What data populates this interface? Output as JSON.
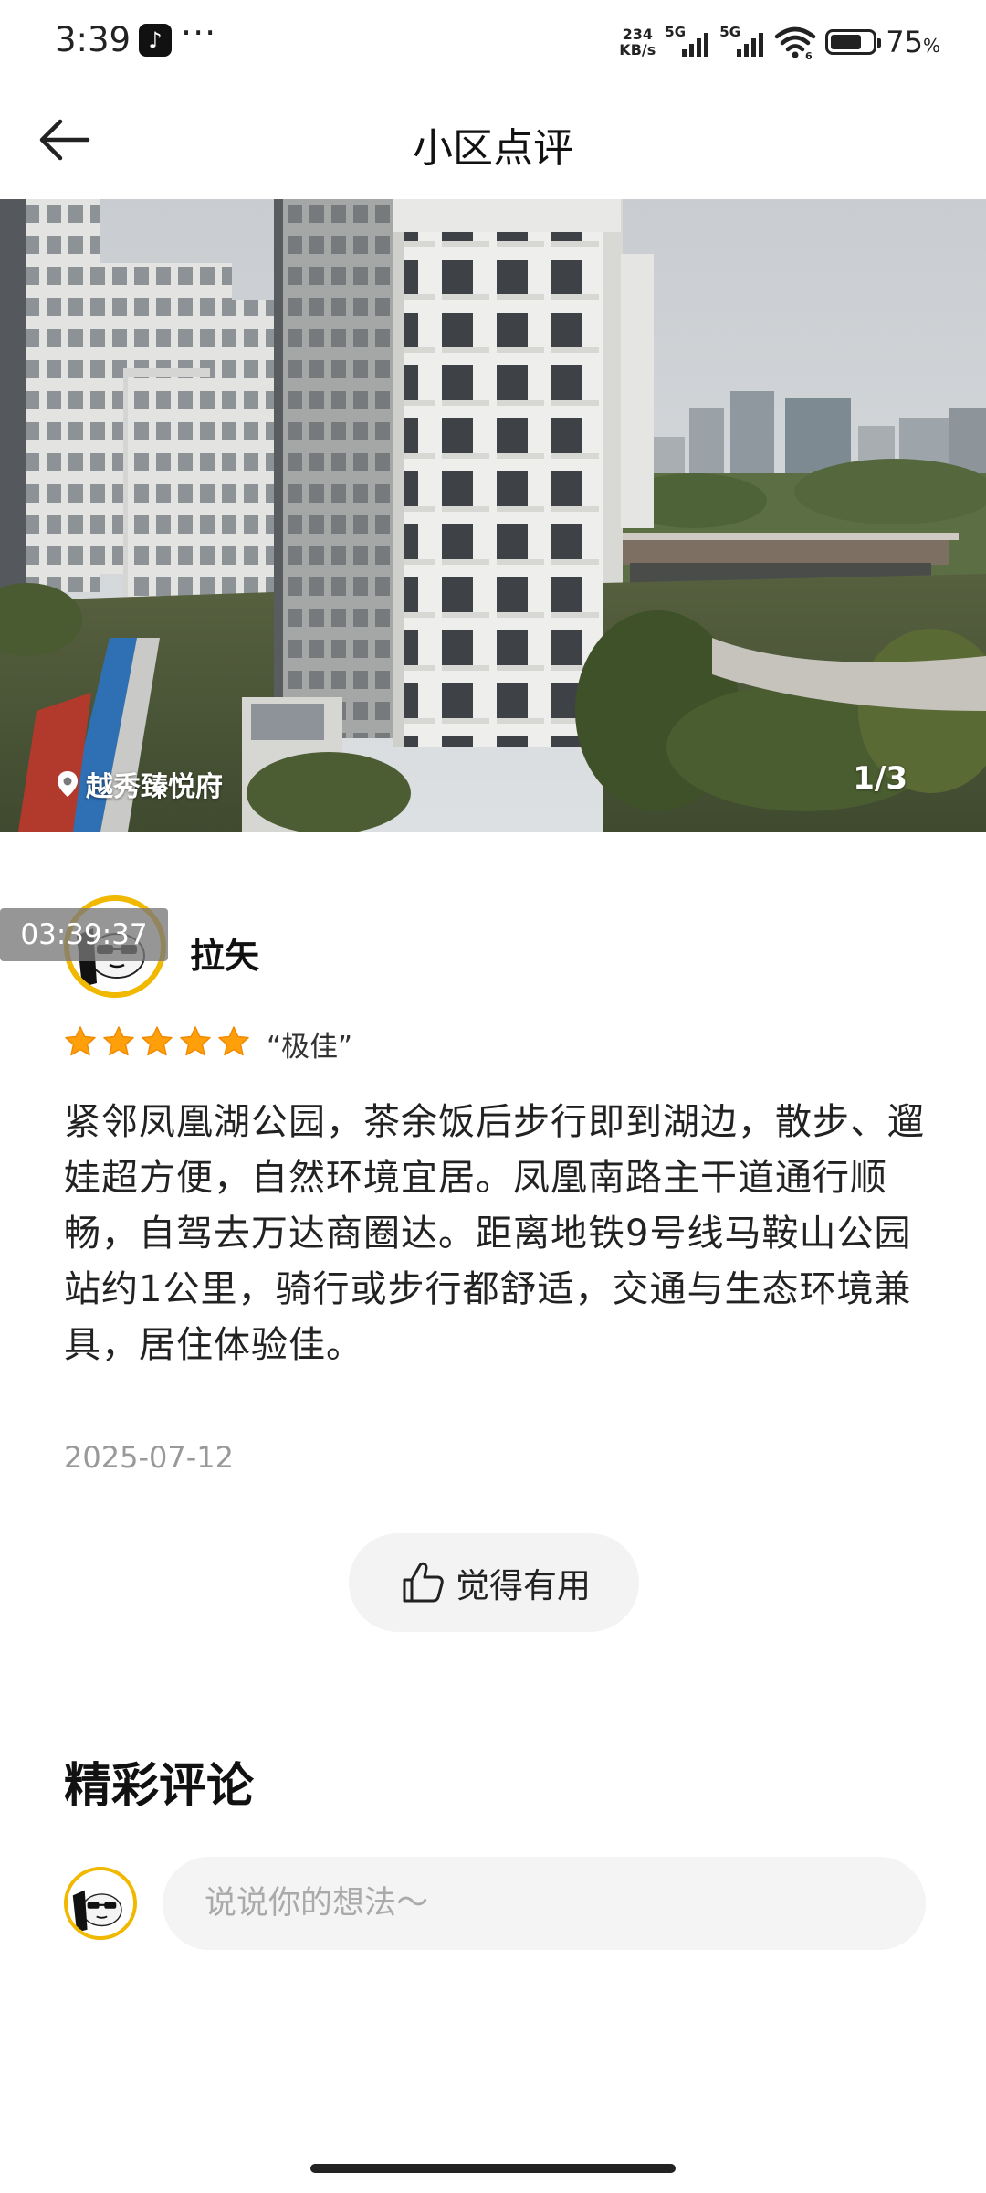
{
  "status_bar": {
    "time": "3:39",
    "net_speed_value": "234",
    "net_speed_unit": "KB/s",
    "signal1_label": "5G",
    "signal2_label": "5G",
    "wifi_badge": "6",
    "battery_percent": "75",
    "battery_unit": "%",
    "battery_level": 0.75
  },
  "header": {
    "title": "小区点评"
  },
  "hero": {
    "location_name": "越秀臻悦府",
    "image_counter": "1/3"
  },
  "review": {
    "overlay_timer": "03:39:37",
    "username": "拉矢",
    "stars": 5,
    "rating_label": "“极佳”",
    "body": "紧邻凤凰湖公园，茶余饭后步行即到湖边，散步、遛娃超方便，自然环境宜居。凤凰南路主干道通行顺畅，自驾去万达商圈达。距离地铁9号线马鞍山公园站约1公里，骑行或步行都舒适，交通与生态环境兼具，居住体验佳。",
    "date": "2025-07-12",
    "helpful_label": "觉得有用"
  },
  "comments": {
    "section_title": "精彩评论",
    "input_placeholder": "说说你的想法～"
  },
  "colors": {
    "accent_yellow": "#f1b800",
    "star_orange": "#ff9f0a"
  }
}
